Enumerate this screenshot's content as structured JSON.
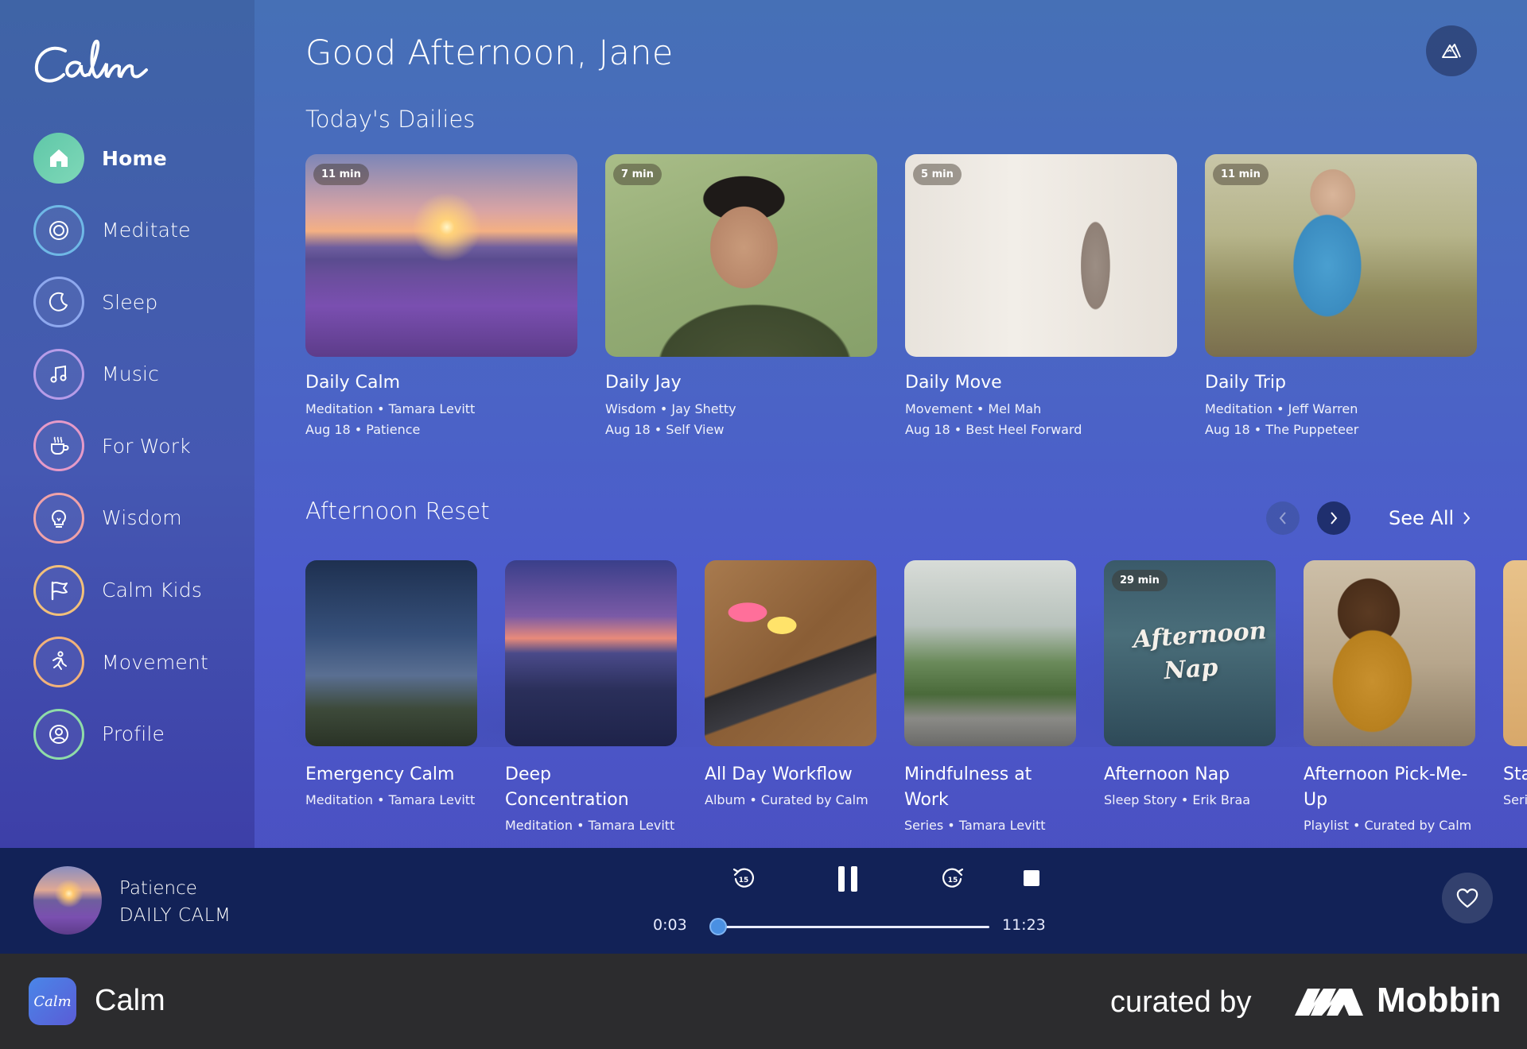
{
  "app": {
    "greeting": "Good Afternoon, Jane",
    "logo_text": "Calm"
  },
  "sidebar": {
    "items": [
      {
        "label": "Home",
        "icon": "home-icon",
        "active": true,
        "color": "#6fd0b0"
      },
      {
        "label": "Meditate",
        "icon": "meditate-icon",
        "color": "#6fb8e6"
      },
      {
        "label": "Sleep",
        "icon": "moon-icon",
        "color": "#8ea8ee"
      },
      {
        "label": "Music",
        "icon": "music-icon",
        "color": "#b79ce8"
      },
      {
        "label": "For Work",
        "icon": "coffee-cup-icon",
        "color": "#e59ac8"
      },
      {
        "label": "Wisdom",
        "icon": "lightbulb-icon",
        "color": "#f0a2a8"
      },
      {
        "label": "Calm Kids",
        "icon": "flag-icon",
        "color": "#f2c07a"
      },
      {
        "label": "Movement",
        "icon": "movement-icon",
        "color": "#f2b27a"
      },
      {
        "label": "Profile",
        "icon": "profile-icon",
        "color": "#8fdca8"
      }
    ]
  },
  "dailies": {
    "title": "Today's Dailies",
    "cards": [
      {
        "duration": "11 min",
        "title": "Daily Calm",
        "line1": "Meditation • Tamara Levitt",
        "line2": "Aug 18 • Patience"
      },
      {
        "duration": "7 min",
        "title": "Daily Jay",
        "line1": "Wisdom • Jay Shetty",
        "line2": "Aug 18 • Self View"
      },
      {
        "duration": "5 min",
        "title": "Daily Move",
        "line1": "Movement • Mel Mah",
        "line2": "Aug 18 • Best Heel Forward"
      },
      {
        "duration": "11 min",
        "title": "Daily Trip",
        "line1": "Meditation • Jeff Warren",
        "line2": "Aug 18 • The Puppeteer"
      }
    ]
  },
  "reset": {
    "title": "Afternoon Reset",
    "see_all": "See All",
    "cards": [
      {
        "title": "Emergency Calm",
        "sub": "Meditation • Tamara Levitt"
      },
      {
        "title": "Deep Concentration",
        "sub": "Meditation • Tamara Levitt"
      },
      {
        "title": "All Day Workflow",
        "sub": "Album • Curated by Calm"
      },
      {
        "title": "Mindfulness at Work",
        "sub": "Series • Tamara Levitt"
      },
      {
        "title": "Afternoon Nap",
        "sub": "Sleep Story • Erik Braa",
        "duration": "29 min",
        "overlay": "Afternoon Nap"
      },
      {
        "title": "Afternoon Pick-Me-Up",
        "sub": "Playlist • Curated by Calm"
      },
      {
        "title": "Sta",
        "sub": "Seri"
      }
    ]
  },
  "player": {
    "title": "Patience",
    "subtitle": "DAILY CALM",
    "elapsed": "0:03",
    "total": "11:23",
    "progress": 0.004,
    "skip_back_label": "15",
    "skip_forward_label": "15"
  },
  "footer": {
    "app_name": "Calm",
    "app_icon_text": "Calm",
    "curated_by": "curated by",
    "brand": "Mobbin"
  }
}
